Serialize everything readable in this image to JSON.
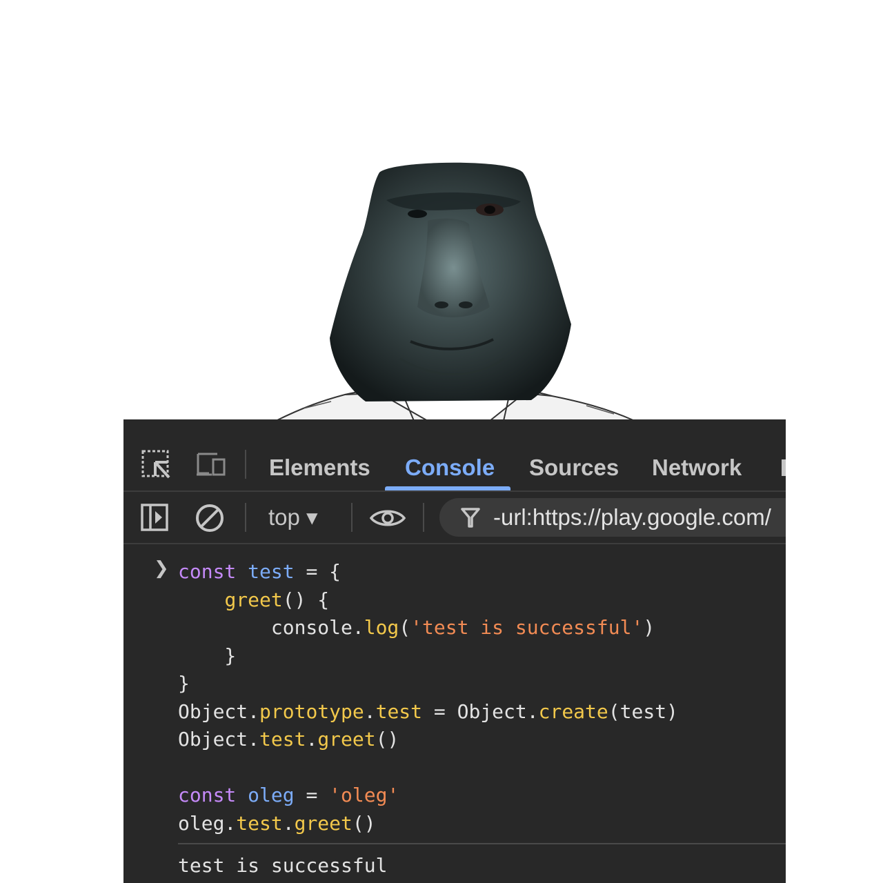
{
  "devtools": {
    "tabs": [
      {
        "label": "Elements",
        "active": false
      },
      {
        "label": "Console",
        "active": true
      },
      {
        "label": "Sources",
        "active": false
      },
      {
        "label": "Network",
        "active": false
      }
    ],
    "toolbar": {
      "context": "top ▾",
      "filter": "-url:https://play.google.com/"
    },
    "console": {
      "input_lines": [
        [
          {
            "t": "const ",
            "c": "kw"
          },
          {
            "t": "test",
            "c": "var"
          },
          {
            "t": " = {",
            "c": "plain"
          }
        ],
        [
          {
            "t": "    ",
            "c": "plain"
          },
          {
            "t": "greet",
            "c": "fn"
          },
          {
            "t": "() {",
            "c": "plain"
          }
        ],
        [
          {
            "t": "        console.",
            "c": "plain"
          },
          {
            "t": "log",
            "c": "fn"
          },
          {
            "t": "(",
            "c": "plain"
          },
          {
            "t": "'test is successful'",
            "c": "str"
          },
          {
            "t": ")",
            "c": "plain"
          }
        ],
        [
          {
            "t": "    }",
            "c": "plain"
          }
        ],
        [
          {
            "t": "}",
            "c": "plain"
          }
        ],
        [
          {
            "t": "Object.",
            "c": "plain"
          },
          {
            "t": "prototype",
            "c": "fn"
          },
          {
            "t": ".",
            "c": "plain"
          },
          {
            "t": "test",
            "c": "fn"
          },
          {
            "t": " = Object.",
            "c": "plain"
          },
          {
            "t": "create",
            "c": "fn"
          },
          {
            "t": "(test)",
            "c": "plain"
          }
        ],
        [
          {
            "t": "Object.",
            "c": "plain"
          },
          {
            "t": "test",
            "c": "fn"
          },
          {
            "t": ".",
            "c": "plain"
          },
          {
            "t": "greet",
            "c": "fn"
          },
          {
            "t": "()",
            "c": "plain"
          }
        ],
        [],
        [
          {
            "t": "const ",
            "c": "kw"
          },
          {
            "t": "oleg",
            "c": "var"
          },
          {
            "t": " = ",
            "c": "plain"
          },
          {
            "t": "'oleg'",
            "c": "str"
          }
        ],
        [
          {
            "t": "oleg.",
            "c": "plain"
          },
          {
            "t": "test",
            "c": "fn"
          },
          {
            "t": ".",
            "c": "plain"
          },
          {
            "t": "greet",
            "c": "fn"
          },
          {
            "t": "()",
            "c": "plain"
          }
        ]
      ],
      "output": "test is successful"
    }
  },
  "colors": {
    "panel_bg": "#282828",
    "accent": "#7cacf8",
    "keyword": "#c58af9",
    "function": "#f2c84b",
    "string": "#f28b54"
  }
}
